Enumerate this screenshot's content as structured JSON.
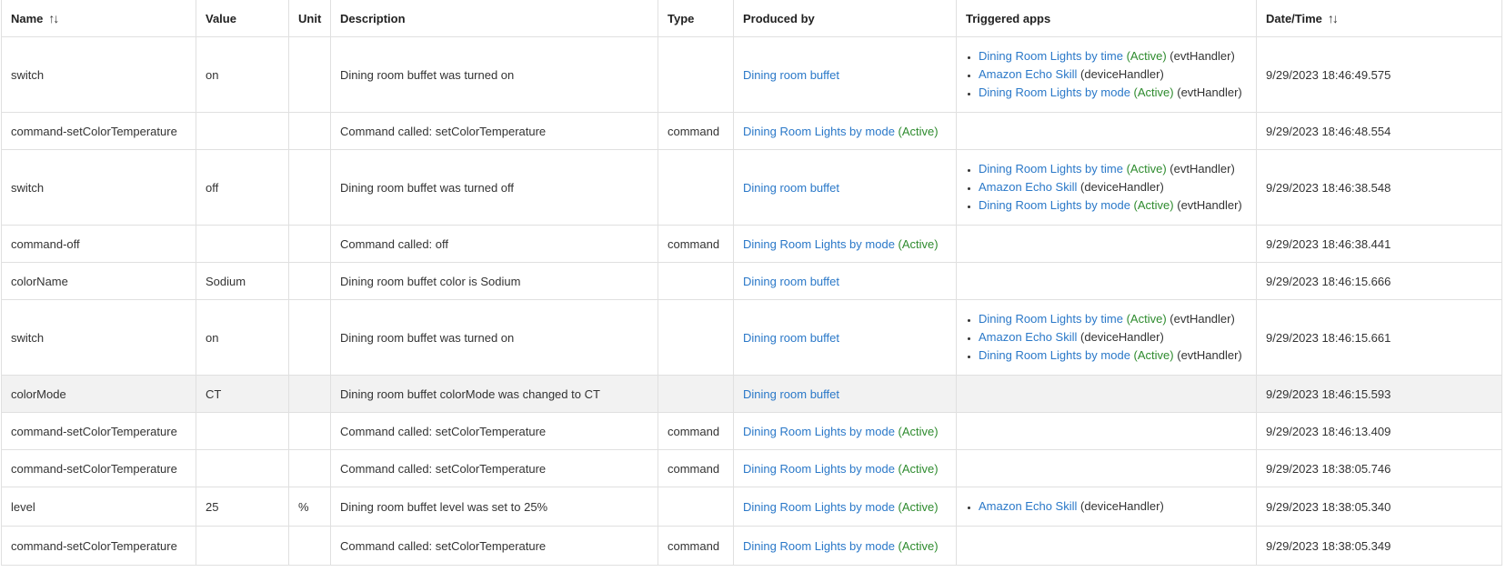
{
  "columns": [
    {
      "label": "Name",
      "sortable": true
    },
    {
      "label": "Value",
      "sortable": false
    },
    {
      "label": "Unit",
      "sortable": false
    },
    {
      "label": "Description",
      "sortable": false
    },
    {
      "label": "Type",
      "sortable": false
    },
    {
      "label": "Produced by",
      "sortable": false
    },
    {
      "label": "Triggered apps",
      "sortable": false
    },
    {
      "label": "Date/Time",
      "sortable": true
    }
  ],
  "sort_icon": "↑↓",
  "active_label": "(Active)",
  "colors": {
    "link": "#2a78c8",
    "active": "#2e8b2e",
    "hover_row": "#f2f2f2"
  },
  "rows": [
    {
      "name": "switch",
      "value": "on",
      "unit": "",
      "description": "Dining room buffet was turned on",
      "type": "",
      "produced_by": {
        "text": "Dining room buffet",
        "active": false
      },
      "apps": [
        {
          "name": "Dining Room Lights by time",
          "active": true,
          "handler": "(evtHandler)"
        },
        {
          "name": "Amazon Echo Skill",
          "active": false,
          "handler": "(deviceHandler)"
        },
        {
          "name": "Dining Room Lights by mode",
          "active": true,
          "handler": "(evtHandler)"
        }
      ],
      "datetime": "9/29/2023 18:46:49.575"
    },
    {
      "name": "command-setColorTemperature",
      "value": "",
      "unit": "",
      "description": "Command called: setColorTemperature",
      "type": "command",
      "produced_by": {
        "text": "Dining Room Lights by mode",
        "active": true
      },
      "apps": [],
      "datetime": "9/29/2023 18:46:48.554"
    },
    {
      "name": "switch",
      "value": "off",
      "unit": "",
      "description": "Dining room buffet was turned off",
      "type": "",
      "produced_by": {
        "text": "Dining room buffet",
        "active": false
      },
      "apps": [
        {
          "name": "Dining Room Lights by time",
          "active": true,
          "handler": "(evtHandler)"
        },
        {
          "name": "Amazon Echo Skill",
          "active": false,
          "handler": "(deviceHandler)"
        },
        {
          "name": "Dining Room Lights by mode",
          "active": true,
          "handler": "(evtHandler)"
        }
      ],
      "datetime": "9/29/2023 18:46:38.548"
    },
    {
      "name": "command-off",
      "value": "",
      "unit": "",
      "description": "Command called: off",
      "type": "command",
      "produced_by": {
        "text": "Dining Room Lights by mode",
        "active": true
      },
      "apps": [],
      "datetime": "9/29/2023 18:46:38.441"
    },
    {
      "name": "colorName",
      "value": "Sodium",
      "unit": "",
      "description": "Dining room buffet color is Sodium",
      "type": "",
      "produced_by": {
        "text": "Dining room buffet",
        "active": false
      },
      "apps": [],
      "datetime": "9/29/2023 18:46:15.666"
    },
    {
      "name": "switch",
      "value": "on",
      "unit": "",
      "description": "Dining room buffet was turned on",
      "type": "",
      "produced_by": {
        "text": "Dining room buffet",
        "active": false
      },
      "apps": [
        {
          "name": "Dining Room Lights by time",
          "active": true,
          "handler": "(evtHandler)"
        },
        {
          "name": "Amazon Echo Skill",
          "active": false,
          "handler": "(deviceHandler)"
        },
        {
          "name": "Dining Room Lights by mode",
          "active": true,
          "handler": "(evtHandler)"
        }
      ],
      "datetime": "9/29/2023 18:46:15.661"
    },
    {
      "name": "colorMode",
      "value": "CT",
      "unit": "",
      "description": "Dining room buffet colorMode was changed to CT",
      "type": "",
      "produced_by": {
        "text": "Dining room buffet",
        "active": false
      },
      "apps": [],
      "datetime": "9/29/2023 18:46:15.593",
      "hovered": true
    },
    {
      "name": "command-setColorTemperature",
      "value": "",
      "unit": "",
      "description": "Command called: setColorTemperature",
      "type": "command",
      "produced_by": {
        "text": "Dining Room Lights by mode",
        "active": true
      },
      "apps": [],
      "datetime": "9/29/2023 18:46:13.409"
    },
    {
      "name": "command-setColorTemperature",
      "value": "",
      "unit": "",
      "description": "Command called: setColorTemperature",
      "type": "command",
      "produced_by": {
        "text": "Dining Room Lights by mode",
        "active": true
      },
      "apps": [],
      "datetime": "9/29/2023 18:38:05.746"
    },
    {
      "name": "level",
      "value": "25",
      "unit": "%",
      "description": "Dining room buffet level was set to 25%",
      "type": "",
      "produced_by": {
        "text": "Dining Room Lights by mode",
        "active": true
      },
      "apps": [
        {
          "name": "Amazon Echo Skill",
          "active": false,
          "handler": "(deviceHandler)"
        }
      ],
      "datetime": "9/29/2023 18:38:05.340"
    },
    {
      "name": "command-setColorTemperature",
      "value": "",
      "unit": "",
      "description": "Command called: setColorTemperature",
      "type": "command",
      "produced_by": {
        "text": "Dining Room Lights by mode",
        "active": true
      },
      "apps": [],
      "datetime": "9/29/2023 18:38:05.349"
    }
  ]
}
